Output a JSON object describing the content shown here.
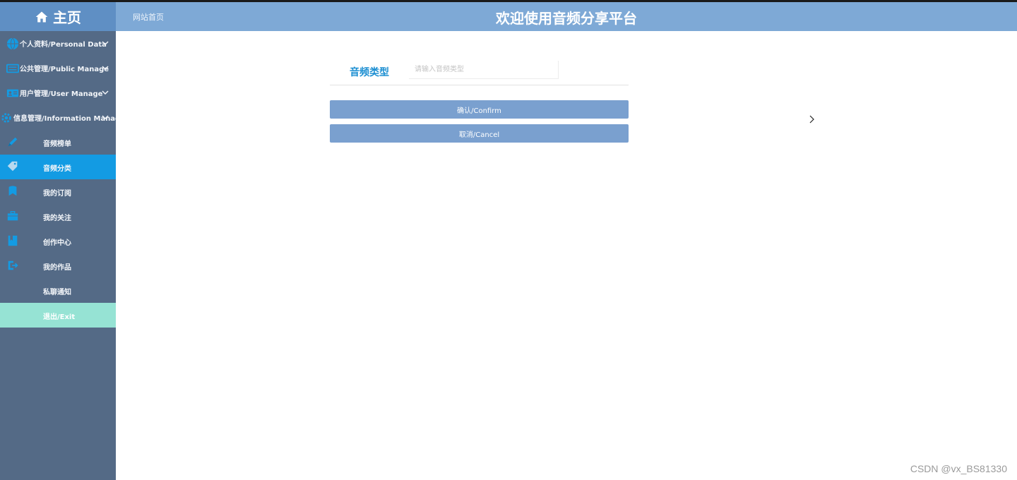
{
  "header": {
    "brand_label": "主页",
    "breadcrumb": "网站首页",
    "site_title": "欢迎使用音频分享平台"
  },
  "sidebar": {
    "groups": [
      {
        "label": "个人资料/Personal Data",
        "icon": "globe-icon"
      },
      {
        "label": "公共管理/Public Manage",
        "icon": "keyboard-icon"
      },
      {
        "label": "用户管理/User Manage",
        "icon": "id-card-icon"
      },
      {
        "label": "信息管理/Information Manage",
        "icon": "gear-icon"
      }
    ],
    "items": [
      {
        "label": "音频榜单",
        "icon": "pencil-icon"
      },
      {
        "label": "音频分类",
        "icon": "tag-icon"
      },
      {
        "label": "我的订阅",
        "icon": "bookmark-icon"
      },
      {
        "label": "我的关注",
        "icon": "briefcase-icon"
      },
      {
        "label": "创作中心",
        "icon": "book-icon"
      },
      {
        "label": "我的作品",
        "icon": "exit-icon"
      },
      {
        "label": "私聊通知",
        "icon": ""
      }
    ],
    "exit_label": "退出/Exit"
  },
  "form": {
    "field_label": "音频类型",
    "field_placeholder": "请输入音频类型",
    "field_value": "",
    "confirm_label": "确认/Confirm",
    "cancel_label": "取消/Cancel"
  },
  "watermark": "CSDN @vx_BS81330",
  "colors": {
    "header": "#7ea9d6",
    "brand": "#5f8fc4",
    "sidebar": "#546a86",
    "active_item": "#139be3",
    "exit_item": "#96e3d4",
    "button": "#7aa0cf",
    "label": "#1d8fd2"
  }
}
